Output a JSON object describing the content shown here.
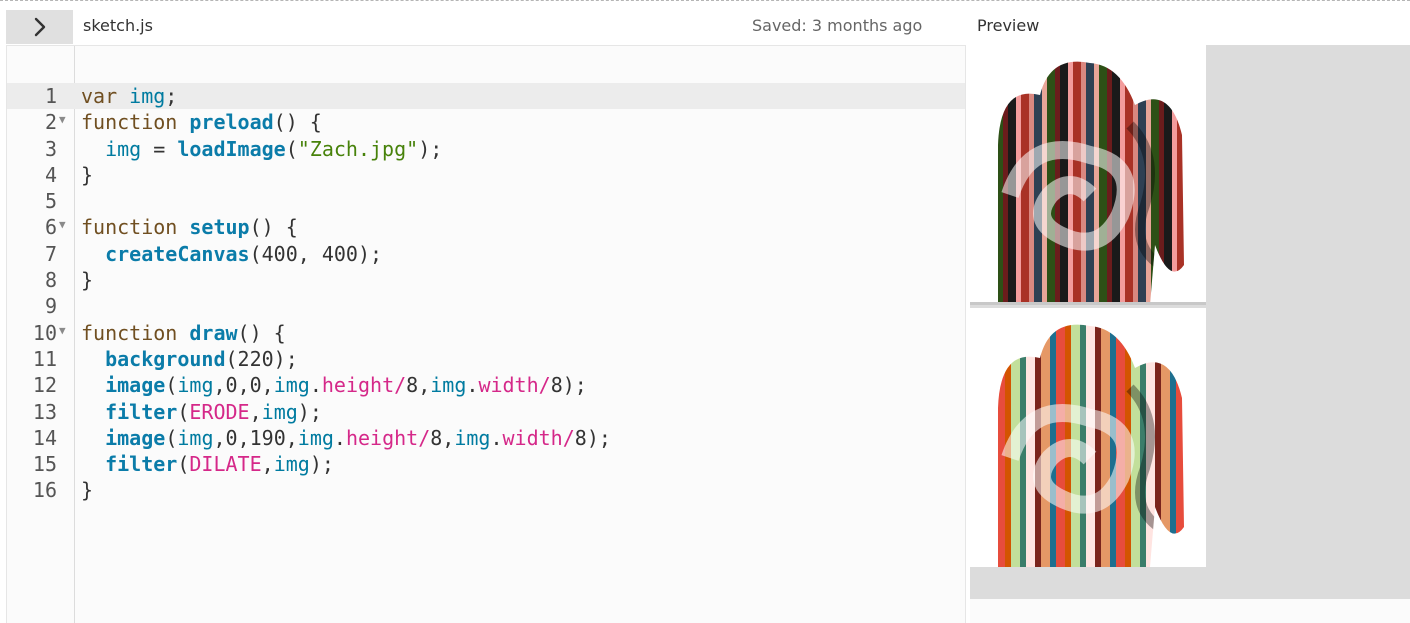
{
  "header": {
    "toggle_icon": "chevron-right-icon",
    "filename": "sketch.js",
    "saved_status": "Saved: 3 months ago",
    "preview_label": "Preview"
  },
  "editor": {
    "active_line": 1,
    "lines": [
      {
        "n": "1",
        "fold": false,
        "tokens": [
          {
            "t": "var ",
            "c": "kw"
          },
          {
            "t": "img",
            "c": "var"
          },
          {
            "t": ";",
            "c": "punc"
          }
        ]
      },
      {
        "n": "2",
        "fold": true,
        "tokens": [
          {
            "t": "function ",
            "c": "kw"
          },
          {
            "t": "preload",
            "c": "fn"
          },
          {
            "t": "() {",
            "c": "punc"
          }
        ]
      },
      {
        "n": "3",
        "fold": false,
        "tokens": [
          {
            "t": "  ",
            "c": "punc"
          },
          {
            "t": "img",
            "c": "var"
          },
          {
            "t": " = ",
            "c": "punc"
          },
          {
            "t": "loadImage",
            "c": "fn"
          },
          {
            "t": "(",
            "c": "punc"
          },
          {
            "t": "\"Zach.jpg\"",
            "c": "str"
          },
          {
            "t": ");",
            "c": "punc"
          }
        ]
      },
      {
        "n": "4",
        "fold": false,
        "tokens": [
          {
            "t": "}",
            "c": "punc"
          }
        ]
      },
      {
        "n": "5",
        "fold": false,
        "tokens": []
      },
      {
        "n": "6",
        "fold": true,
        "tokens": [
          {
            "t": "function ",
            "c": "kw"
          },
          {
            "t": "setup",
            "c": "fn"
          },
          {
            "t": "() {",
            "c": "punc"
          }
        ]
      },
      {
        "n": "7",
        "fold": false,
        "tokens": [
          {
            "t": "  ",
            "c": "punc"
          },
          {
            "t": "createCanvas",
            "c": "fn"
          },
          {
            "t": "(400, 400);",
            "c": "punc"
          }
        ]
      },
      {
        "n": "8",
        "fold": false,
        "tokens": [
          {
            "t": "}",
            "c": "punc"
          }
        ]
      },
      {
        "n": "9",
        "fold": false,
        "tokens": []
      },
      {
        "n": "10",
        "fold": true,
        "tokens": [
          {
            "t": "function ",
            "c": "kw"
          },
          {
            "t": "draw",
            "c": "fn"
          },
          {
            "t": "() {",
            "c": "punc"
          }
        ]
      },
      {
        "n": "11",
        "fold": false,
        "tokens": [
          {
            "t": "  ",
            "c": "punc"
          },
          {
            "t": "background",
            "c": "fn"
          },
          {
            "t": "(220);",
            "c": "punc"
          }
        ]
      },
      {
        "n": "12",
        "fold": false,
        "tokens": [
          {
            "t": "  ",
            "c": "punc"
          },
          {
            "t": "image",
            "c": "fn"
          },
          {
            "t": "(",
            "c": "punc"
          },
          {
            "t": "img",
            "c": "var"
          },
          {
            "t": ",0,0,",
            "c": "punc"
          },
          {
            "t": "img",
            "c": "var"
          },
          {
            "t": ".",
            "c": "punc"
          },
          {
            "t": "height",
            "c": "prop"
          },
          {
            "t": "/",
            "c": "const"
          },
          {
            "t": "8,",
            "c": "punc"
          },
          {
            "t": "img",
            "c": "var"
          },
          {
            "t": ".",
            "c": "punc"
          },
          {
            "t": "width",
            "c": "prop"
          },
          {
            "t": "/",
            "c": "const"
          },
          {
            "t": "8);",
            "c": "punc"
          }
        ]
      },
      {
        "n": "13",
        "fold": false,
        "tokens": [
          {
            "t": "  ",
            "c": "punc"
          },
          {
            "t": "filter",
            "c": "fn"
          },
          {
            "t": "(",
            "c": "punc"
          },
          {
            "t": "ERODE",
            "c": "const"
          },
          {
            "t": ",",
            "c": "punc"
          },
          {
            "t": "img",
            "c": "var"
          },
          {
            "t": ");",
            "c": "punc"
          }
        ]
      },
      {
        "n": "14",
        "fold": false,
        "tokens": [
          {
            "t": "  ",
            "c": "punc"
          },
          {
            "t": "image",
            "c": "fn"
          },
          {
            "t": "(",
            "c": "punc"
          },
          {
            "t": "img",
            "c": "var"
          },
          {
            "t": ",0,190,",
            "c": "punc"
          },
          {
            "t": "img",
            "c": "var"
          },
          {
            "t": ".",
            "c": "punc"
          },
          {
            "t": "height",
            "c": "prop"
          },
          {
            "t": "/",
            "c": "const"
          },
          {
            "t": "8,",
            "c": "punc"
          },
          {
            "t": "img",
            "c": "var"
          },
          {
            "t": ".",
            "c": "punc"
          },
          {
            "t": "width",
            "c": "prop"
          },
          {
            "t": "/",
            "c": "const"
          },
          {
            "t": "8);",
            "c": "punc"
          }
        ]
      },
      {
        "n": "15",
        "fold": false,
        "tokens": [
          {
            "t": "  ",
            "c": "punc"
          },
          {
            "t": "filter",
            "c": "fn"
          },
          {
            "t": "(",
            "c": "punc"
          },
          {
            "t": "DILATE",
            "c": "const"
          },
          {
            "t": ",",
            "c": "punc"
          },
          {
            "t": "img",
            "c": "var"
          },
          {
            "t": ");",
            "c": "punc"
          }
        ]
      },
      {
        "n": "16",
        "fold": false,
        "tokens": [
          {
            "t": "}",
            "c": "punc"
          }
        ]
      }
    ]
  },
  "preview": {
    "stripe_colors": [
      "#c0392b",
      "#e8a598",
      "#1e6f8f",
      "#f4d9c6",
      "#2d5016",
      "#e74c3c",
      "#f7c6c0",
      "#6b1c1c",
      "#d35400",
      "#fbeee6",
      "#1a1a1a",
      "#c2df9b",
      "#8e2b2b",
      "#f39c9c",
      "#3b7d6a",
      "#e6c2a8",
      "#a93226",
      "#ffe4e1",
      "#556b2f",
      "#d98880",
      "#7b241c",
      "#f5b7b1",
      "#2e4053",
      "#e59866"
    ]
  }
}
